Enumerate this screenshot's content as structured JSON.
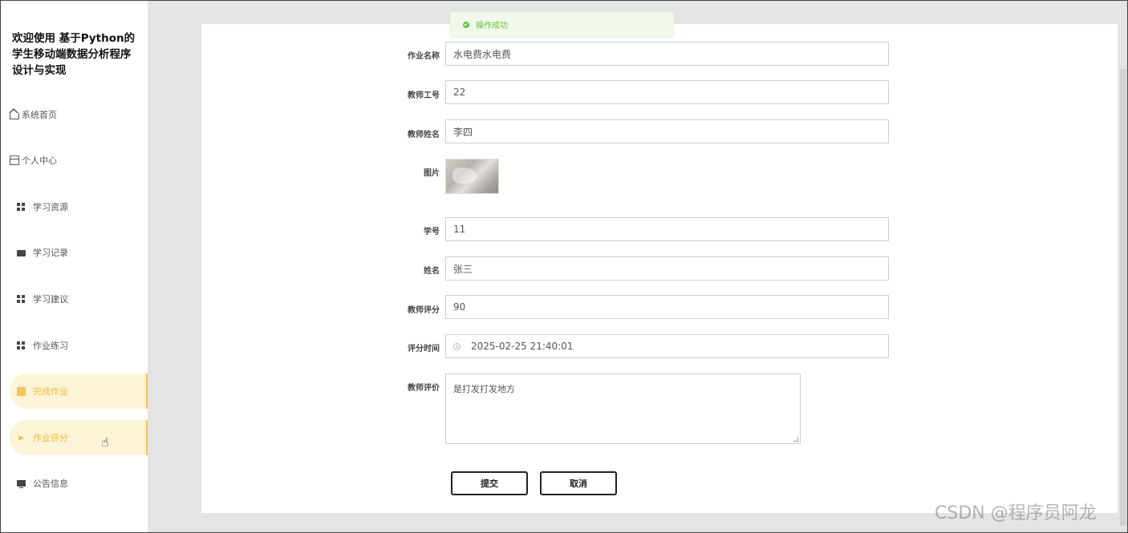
{
  "sidebar": {
    "title": "欢迎使用 基于Python的学生移动端数据分析程序设计与实现",
    "items": [
      {
        "label": "系统首页",
        "icon": "home-icon"
      },
      {
        "label": "个人中心",
        "icon": "user-card-icon"
      },
      {
        "label": "学习资源",
        "icon": "grid-icon"
      },
      {
        "label": "学习记录",
        "icon": "briefcase-icon"
      },
      {
        "label": "学习建议",
        "icon": "grid-icon"
      },
      {
        "label": "作业练习",
        "icon": "grid-icon"
      },
      {
        "label": "完成作业",
        "icon": "clipboard-icon"
      },
      {
        "label": "作业评分",
        "icon": "send-icon"
      },
      {
        "label": "公告信息",
        "icon": "monitor-icon"
      }
    ],
    "active_color": "#f0b840"
  },
  "toast": {
    "message": "操作成功",
    "color": "#67c23a"
  },
  "form": {
    "homework_name": {
      "label": "作业名称",
      "value": "水电费水电费"
    },
    "teacher_id": {
      "label": "教师工号",
      "value": "22"
    },
    "teacher_name": {
      "label": "教师姓名",
      "value": "李四"
    },
    "image": {
      "label": "图片"
    },
    "student_id": {
      "label": "学号",
      "value": "11"
    },
    "student_name": {
      "label": "姓名",
      "value": "张三"
    },
    "teacher_score": {
      "label": "教师评分",
      "value": "90"
    },
    "score_time": {
      "label": "评分时间",
      "value": "2025-02-25 21:40:01"
    },
    "teacher_comment": {
      "label": "教师评价",
      "value": "是打发打发地方"
    }
  },
  "buttons": {
    "submit": "提交",
    "cancel": "取消"
  },
  "watermark": "CSDN @程序员阿龙"
}
